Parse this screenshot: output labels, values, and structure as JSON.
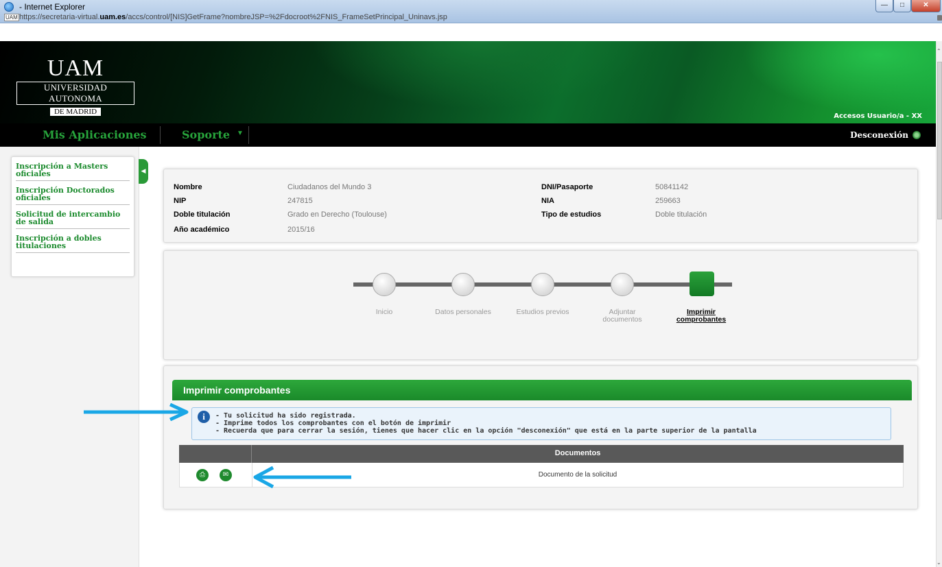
{
  "window": {
    "title": "- Internet Explorer",
    "url_prefix": "https://secretaria-virtual.",
    "url_domain": "uam.es",
    "url_path": "/accs/control/[NIS]GetFrame?nombreJSP=%2Fdocroot%2FNIS_FrameSetPrincipal_Uninavs.jsp",
    "url_icon": "UAM"
  },
  "header": {
    "logo_main": "UAM",
    "logo_line1": "UNIVERSIDAD AUTONOMA",
    "logo_line2": "DE MADRID",
    "user_access": "Accesos Usuario/a - XX"
  },
  "nav": {
    "apps": "Mis Aplicaciones",
    "support": "Soporte",
    "logout": "Desconexión"
  },
  "sidebar": {
    "items": [
      {
        "label": "Inscripción a Masters oficiales"
      },
      {
        "label": "Inscripción Doctorados oficiales"
      },
      {
        "label": "Solicitud de intercambio de salida"
      },
      {
        "label": "Inscripción a dobles titulaciones"
      }
    ]
  },
  "info": {
    "name_label": "Nombre",
    "name_value": "Ciudadanos del Mundo 3",
    "nip_label": "NIP",
    "nip_value": "247815",
    "double_label": "Doble titulación",
    "double_value": "Grado en Derecho (Toulouse)",
    "year_label": "Año académico",
    "year_value": "2015/16",
    "dni_label": "DNI/Pasaporte",
    "dni_value": "50841142",
    "nia_label": "NIA",
    "nia_value": "259663",
    "type_label": "Tipo de estudios",
    "type_value": "Doble titulación"
  },
  "steps": [
    {
      "label": "Inicio"
    },
    {
      "label": "Datos personales"
    },
    {
      "label": "Estudios previos"
    },
    {
      "label": "Adjuntar documentos"
    },
    {
      "label": "Imprimir comprobantes",
      "active": true
    }
  ],
  "print": {
    "title": "Imprimir comprobantes",
    "messages": [
      "- Tu solicitud ha sido registrada.",
      "- Imprime todos los comprobantes con el botón de imprimir",
      "- Recuerda que para cerrar la sesión, tienes que hacer clic en la opción \"desconexión\" que está en la parte superior de la pantalla"
    ],
    "table_header": "Documentos",
    "row_document": "Documento de la solicitud"
  },
  "colors": {
    "brand_green": "#1a8a2c",
    "arrow_blue": "#1aa7e6"
  }
}
